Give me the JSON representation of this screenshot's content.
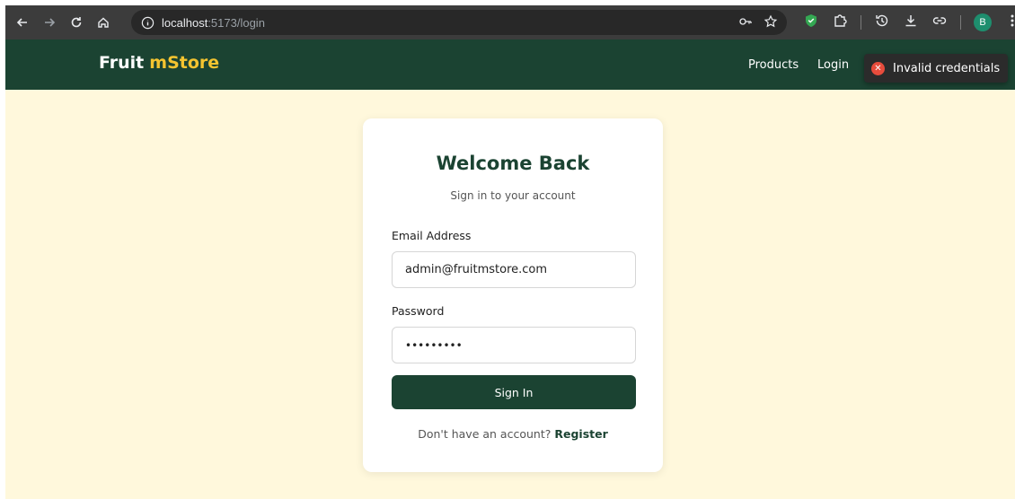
{
  "browser": {
    "url_host": "localhost",
    "url_path": ":5173/login",
    "profile_initial": "B",
    "icons": [
      "back-icon",
      "forward-icon",
      "reload-icon",
      "home-icon",
      "site-info-icon",
      "key-icon",
      "star-icon",
      "shield-extension-icon",
      "puzzle-icon",
      "history-icon",
      "download-icon",
      "link-icon",
      "menu-icon"
    ]
  },
  "header": {
    "brand_main": "Fruit",
    "brand_accent": "mStore",
    "nav": {
      "products": "Products",
      "login": "Login"
    },
    "toast": {
      "message": "Invalid credentials",
      "icon": "error-icon"
    }
  },
  "login": {
    "title": "Welcome Back",
    "subtitle": "Sign in to your account",
    "email_label": "Email Address",
    "email_value": "admin@fruitmstore.com",
    "password_label": "Password",
    "password_value": "•••••••••",
    "submit_label": "Sign In",
    "register_prompt": "Don't have an account?",
    "register_link": "Register"
  },
  "colors": {
    "header_bg": "#1b4332",
    "brand_accent": "#f4c430",
    "page_bg": "#fff8dc",
    "toast_error": "#e74c3c"
  }
}
